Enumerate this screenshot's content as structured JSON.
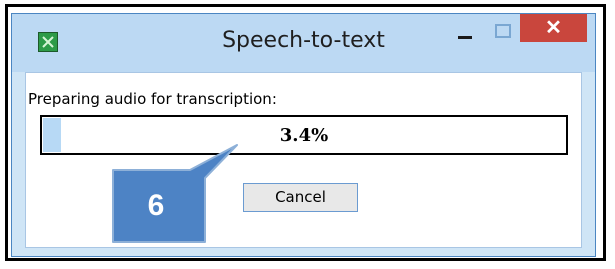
{
  "window": {
    "title": "Speech-to-text",
    "close_glyph": "✕",
    "icons": [
      "app-icon",
      "minimize-icon",
      "maximize-icon",
      "close-icon"
    ]
  },
  "dialog": {
    "status_label": "Preparing audio for transcription:",
    "progress_text": "3.4%",
    "progress_value": 3.4,
    "cancel_label": "Cancel"
  },
  "callout": {
    "number": "6",
    "fill_color": "#4d83c5",
    "border_color": "#8db0d8"
  },
  "colors": {
    "titlebar": "#bcd9f3",
    "window_frame": "#cfe5f6",
    "close_button": "#c9463d",
    "progress_fill": "#b7d9f5"
  }
}
